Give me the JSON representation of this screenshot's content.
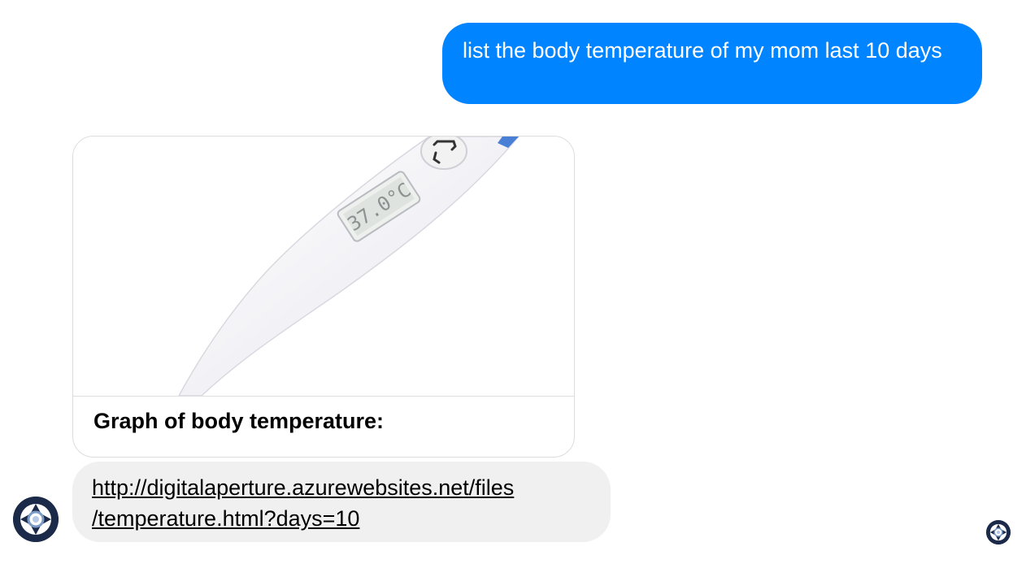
{
  "conversation": {
    "user_message": "list the body temperature of my mom last 10 days",
    "card": {
      "image_name": "digital-thermometer",
      "display_reading": "37.0°C",
      "title": "Graph of body temperature:"
    },
    "bot_link": "http://digitalaperture.azurewebsites.net/files/temperature.html?days=10",
    "bot_link_lines": [
      "http://digitalaperture.azurewebsites.net/files",
      "/temperature.html?days=10"
    ]
  },
  "colors": {
    "user_bubble": "#0084ff",
    "bot_bubble": "#f0f0f0",
    "avatar": "#1c2a4a"
  },
  "icons": {
    "bot_avatar": "aperture-logo",
    "read_receipt": "aperture-logo-small"
  }
}
